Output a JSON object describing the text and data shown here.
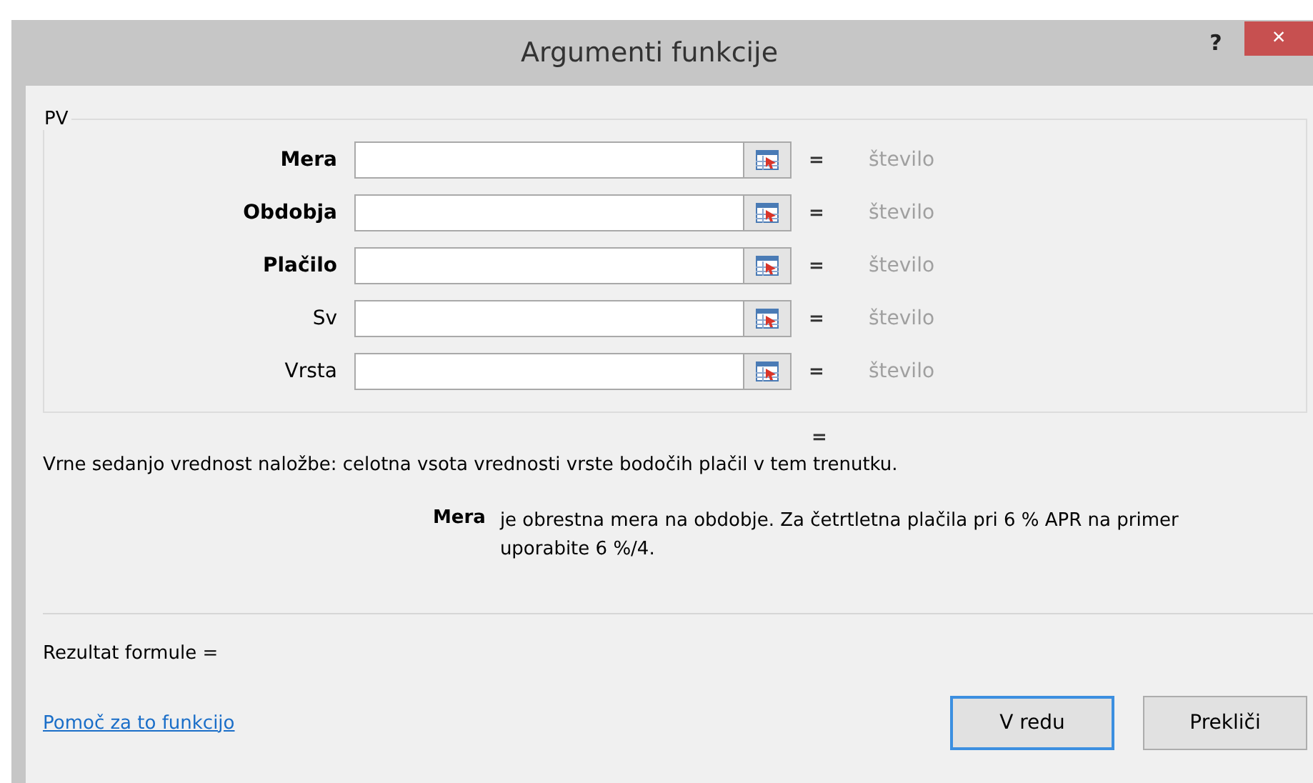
{
  "window": {
    "title": "Argumenti funkcije",
    "help": "?",
    "close": "×"
  },
  "function_group": {
    "name": "PV",
    "arguments": [
      {
        "label": "Mera",
        "required": true,
        "equals": "=",
        "result": "število"
      },
      {
        "label": "Obdobja",
        "required": true,
        "equals": "=",
        "result": "število"
      },
      {
        "label": "Plačilo",
        "required": true,
        "equals": "=",
        "result": "število"
      },
      {
        "label": "Sv",
        "required": false,
        "equals": "=",
        "result": "število"
      },
      {
        "label": "Vrsta",
        "required": false,
        "equals": "=",
        "result": "število"
      }
    ]
  },
  "function_result_equals": "=",
  "description": "Vrne sedanjo vrednost naložbe: celotna vsota vrednosti vrste bodočih plačil v tem trenutku.",
  "argument_help": {
    "name": "Mera",
    "text": "je obrestna mera na obdobje. Za četrtletna plačila pri 6 % APR na primer uporabite 6 %/4."
  },
  "formula_result": "Rezultat formule =",
  "help_link": "Pomoč za to funkcijo",
  "buttons": [
    {
      "label": "V redu",
      "default": true
    },
    {
      "label": "Prekliči",
      "default": false
    }
  ]
}
